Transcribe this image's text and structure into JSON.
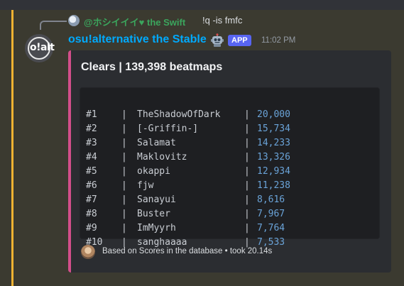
{
  "reply": {
    "username": "@ホシイイイ♥ the Swift",
    "content": "!q -is fmfc"
  },
  "message": {
    "author": "osu!alternative the Stable",
    "avatar_text": "o!alt",
    "badge": "APP",
    "timestamp": "11:02 PM"
  },
  "embed": {
    "accent_color": "#d34e8a",
    "title": "Clears | 139,398 beatmaps",
    "rows": [
      {
        "rank": "#1",
        "name": "TheShadowOfDark",
        "value": "20,000"
      },
      {
        "rank": "#2",
        "name": "[-Griffin-]",
        "value": "15,734"
      },
      {
        "rank": "#3",
        "name": "Salamat",
        "value": "14,233"
      },
      {
        "rank": "#4",
        "name": "Maklovitz",
        "value": "13,326"
      },
      {
        "rank": "#5",
        "name": "okappi",
        "value": "12,934"
      },
      {
        "rank": "#6",
        "name": "fjw",
        "value": "11,238"
      },
      {
        "rank": "#7",
        "name": "Sanayui",
        "value": "8,616"
      },
      {
        "rank": "#8",
        "name": "Buster",
        "value": "7,967"
      },
      {
        "rank": "#9",
        "name": "ImMyyrh",
        "value": "7,764"
      },
      {
        "rank": "#10",
        "name": "sanghaaaa",
        "value": "7,533"
      }
    ],
    "separator": "|",
    "footer": "Based on Scores in the database • took 20.14s"
  },
  "colors": {
    "mention_highlight": "#f0b232",
    "author_color": "#00aafc",
    "reply_username_color": "#3ba55d",
    "app_badge": "#5865f2"
  }
}
